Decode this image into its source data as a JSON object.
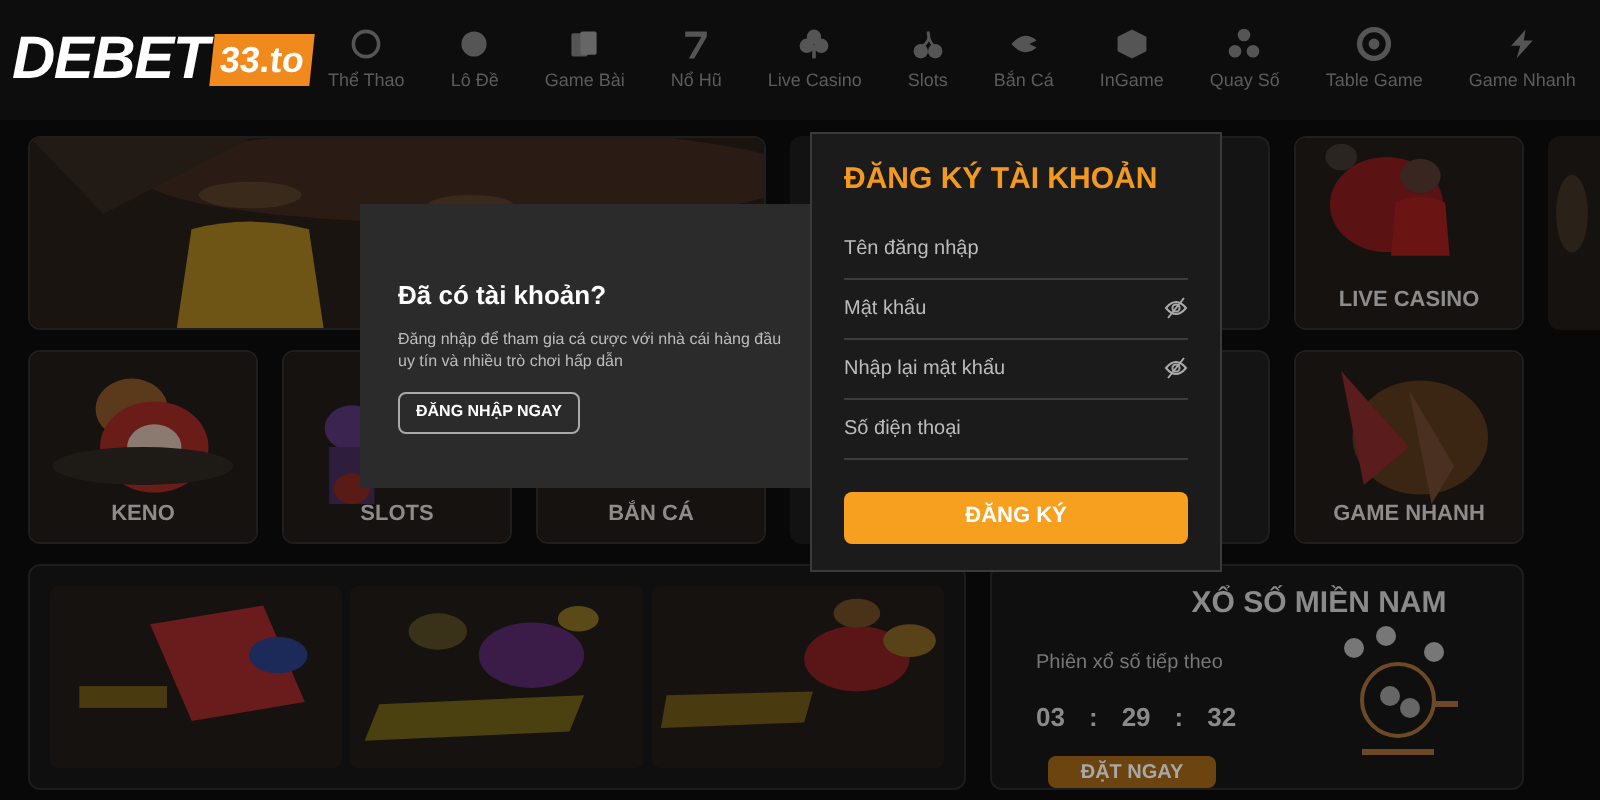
{
  "logo": {
    "text": "DEBET",
    "badge": "33.to"
  },
  "nav": [
    {
      "label": "Thể Thao"
    },
    {
      "label": "Lô Đề"
    },
    {
      "label": "Game Bài"
    },
    {
      "label": "Nổ Hũ"
    },
    {
      "label": "Live Casino"
    },
    {
      "label": "Slots"
    },
    {
      "label": "Bắn Cá"
    },
    {
      "label": "InGame"
    },
    {
      "label": "Quay Số"
    },
    {
      "label": "Table Game"
    },
    {
      "label": "Game Nhanh"
    }
  ],
  "games": [
    {
      "label": "KENO"
    },
    {
      "label": "SLOTS"
    },
    {
      "label": "BẮN CÁ"
    },
    {
      "label": "LIVE CASINO"
    },
    {
      "label": "GAME NHANH"
    }
  ],
  "lottery": {
    "title": "XỔ SỐ MIỀN NAM",
    "subtitle": "Phiên xổ số tiếp theo",
    "countdown": [
      "03",
      ":",
      "29",
      ":",
      "32"
    ],
    "button": "ĐẶT NGAY"
  },
  "login_panel": {
    "title": "Đã có tài khoản?",
    "text": "Đăng nhập để tham gia cá cược với nhà cái hàng đầu uy tín và nhiều trò chơi hấp dẫn",
    "button": "ĐĂNG NHẬP NGAY"
  },
  "register_panel": {
    "title": "ĐĂNG KÝ TÀI KHOẢN",
    "fields": [
      {
        "placeholder": "Tên đăng nhập",
        "kind": "text"
      },
      {
        "placeholder": "Mật khẩu",
        "kind": "password"
      },
      {
        "placeholder": "Nhập lại mật khẩu",
        "kind": "password"
      },
      {
        "placeholder": "Số điện thoại",
        "kind": "text"
      }
    ],
    "button": "ĐĂNG KÝ"
  }
}
